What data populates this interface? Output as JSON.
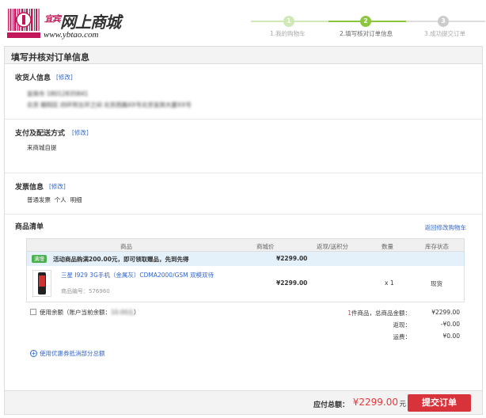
{
  "logo": {
    "name": "网上商城",
    "url": "www.ybtao.com",
    "mark": "宜宾",
    "barcode_text": "宜宾网上商城"
  },
  "steps": [
    {
      "num": "1",
      "label": "1.我的购物车"
    },
    {
      "num": "2",
      "label": "2.填写核对订单信息"
    },
    {
      "num": "3",
      "label": "3.成功提交订单"
    }
  ],
  "page_title": "填写并核对订单信息",
  "edit_label": "[修改]",
  "consignee": {
    "title": "收货人信息",
    "line1": "宜宾市 18012835841",
    "line2": "北京 朝阳区 四环到五环之间 北京西路XX号北京宜宾大厦XX号"
  },
  "payment": {
    "title": "支付及配送方式",
    "method": "来商城自提"
  },
  "invoice": {
    "title": "发票信息",
    "type": "普通发票",
    "who": "个人",
    "content": "明细"
  },
  "cart": {
    "title": "商品清单",
    "back_link": "返回修改购物车",
    "columns": [
      "商品",
      "商城价",
      "返现/送积分",
      "数量",
      "库存状态"
    ],
    "promo": {
      "tag": "满增",
      "text": "活动商品购满200.00元，即可领取赠品，先到先得",
      "price": "¥2299.00"
    },
    "item": {
      "name": "三星 I929 3G手机（金属灰）CDMA2000/GSM 双模双待",
      "code_label": "商品编号：",
      "code": "576960",
      "price": "¥2299.00",
      "qty": "x 1",
      "stock": "现货"
    }
  },
  "balance": {
    "label": "使用余额（账户当前余额：",
    "amount": "10.00元",
    "suffix": "）"
  },
  "summary": {
    "count_prefix": "1",
    "count_suffix": "件商品，总商品金额：",
    "goods_total": "¥2299.00",
    "cashback_label": "返现：",
    "cashback": "-¥0.00",
    "shipping_label": "运费：",
    "shipping": "¥0.00"
  },
  "coupon_link": "使用优惠券抵消部分总额",
  "footer": {
    "total_label": "应付总额：",
    "total": "¥2299.00",
    "unit": "元",
    "submit": "提交订单"
  },
  "colors": {
    "accent_green": "#8cc63f",
    "link": "#3366cc",
    "price_red": "#e4393c",
    "button_red": "#d8333a"
  }
}
